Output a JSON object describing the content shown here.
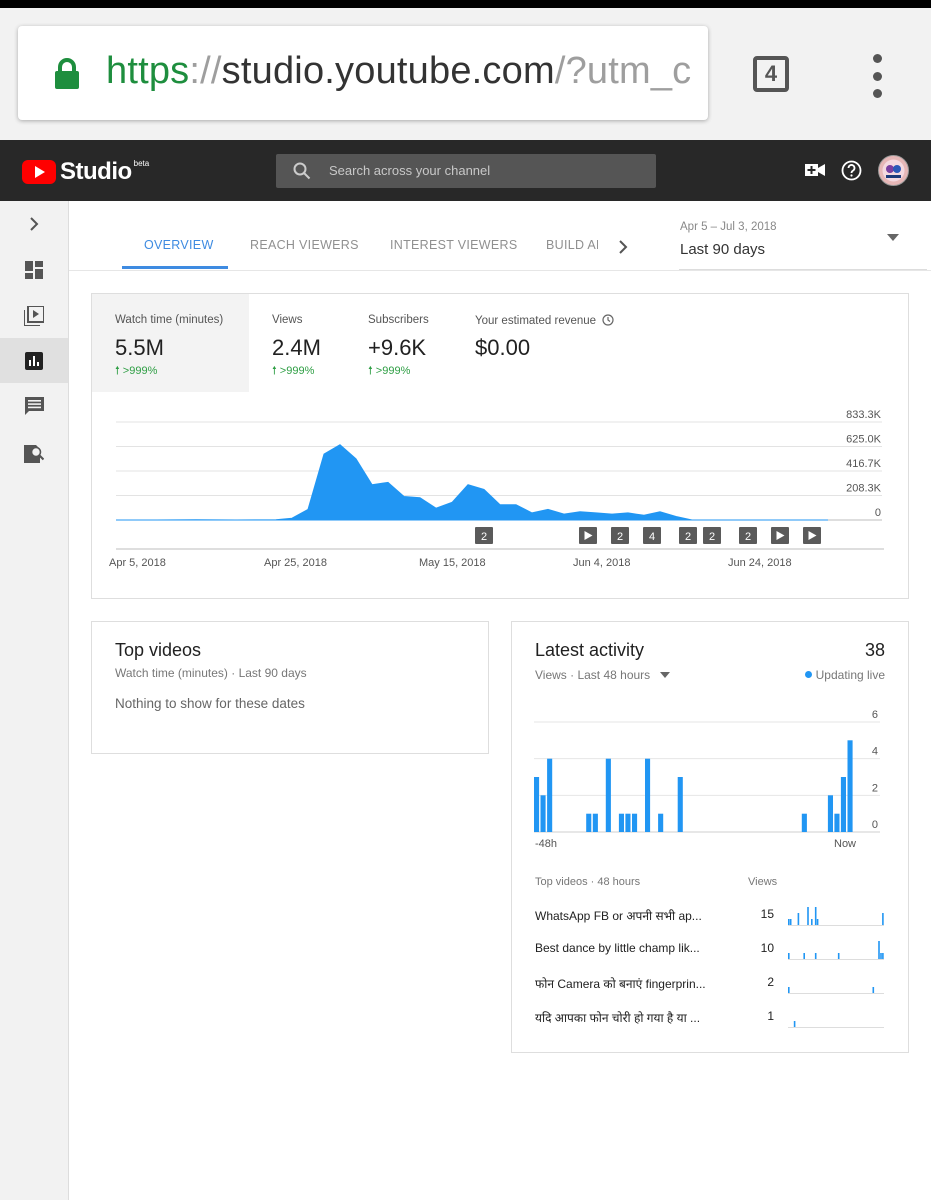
{
  "browser": {
    "url_scheme": "https",
    "url_sep": "://",
    "url_host": "studio.youtube.com",
    "url_rest": "/?utm_c",
    "tab_count": "4"
  },
  "header": {
    "studio_label": "Studio",
    "beta_label": "beta",
    "search_placeholder": "Search across your channel"
  },
  "tabs": [
    {
      "label": "OVERVIEW",
      "active": true
    },
    {
      "label": "REACH VIEWERS"
    },
    {
      "label": "INTEREST VIEWERS"
    },
    {
      "label": "BUILD AN"
    }
  ],
  "date_selector": {
    "range": "Apr 5 – Jul 3, 2018",
    "label": "Last 90 days"
  },
  "metrics": [
    {
      "label": "Watch time (minutes)",
      "value": "5.5M",
      "change": ">999%"
    },
    {
      "label": "Views",
      "value": "2.4M",
      "change": ">999%"
    },
    {
      "label": "Subscribers",
      "value": "+9.6K",
      "change": ">999%"
    },
    {
      "label": "Your estimated revenue",
      "value": "$0.00"
    }
  ],
  "chart_data": [
    {
      "type": "area",
      "y_ticks": [
        "833.3K",
        "625.0K",
        "416.7K",
        "208.3K",
        "0"
      ],
      "x_ticks": [
        "Apr 5, 2018",
        "Apr 25, 2018",
        "May 15, 2018",
        "Jun 4, 2018",
        "Jun 24, 2018"
      ],
      "ylim": [
        0,
        833300
      ],
      "x_days": [
        0,
        5,
        10,
        15,
        20,
        22,
        24,
        26,
        28,
        30,
        32,
        34,
        36,
        38,
        40,
        42,
        44,
        46,
        48,
        50,
        52,
        54,
        56,
        58,
        60,
        62,
        64,
        66,
        68,
        70,
        72,
        75,
        80,
        85,
        89
      ],
      "values": [
        0,
        0,
        2000,
        0,
        2000,
        15000,
        90000,
        560000,
        640000,
        520000,
        300000,
        320000,
        200000,
        190000,
        100000,
        150000,
        300000,
        260000,
        130000,
        130000,
        60000,
        90000,
        50000,
        70000,
        60000,
        50000,
        60000,
        40000,
        70000,
        30000,
        0,
        0,
        0,
        0,
        0
      ],
      "grid": true,
      "annotations": [
        {
          "day": 46,
          "label": "2"
        },
        {
          "day": 59,
          "label": "play"
        },
        {
          "day": 63,
          "label": "2"
        },
        {
          "day": 67,
          "label": "4"
        },
        {
          "day": 71.5,
          "label": "2"
        },
        {
          "day": 74.5,
          "label": "2"
        },
        {
          "day": 79,
          "label": "2"
        },
        {
          "day": 83,
          "label": "play"
        },
        {
          "day": 87,
          "label": "play"
        }
      ]
    },
    {
      "type": "bar",
      "series_label": "Views",
      "y_ticks": [
        "6",
        "4",
        "2",
        "0"
      ],
      "ylim": [
        0,
        6
      ],
      "x_ticks": [
        "-48h",
        "Now"
      ],
      "values": [
        3,
        2,
        4,
        0,
        0,
        0,
        0,
        0,
        1,
        1,
        0,
        4,
        0,
        1,
        1,
        1,
        0,
        4,
        0,
        1,
        0,
        0,
        3,
        0,
        0,
        0,
        0,
        0,
        0,
        0,
        0,
        0,
        0,
        0,
        0,
        0,
        0,
        0,
        0,
        0,
        0,
        1,
        0,
        0,
        0,
        2,
        1,
        3,
        5
      ]
    }
  ],
  "top_videos": {
    "title": "Top videos",
    "subtitle": "Watch time (minutes) · Last 90 days",
    "empty_text": "Nothing to show for these dates"
  },
  "latest_activity": {
    "title": "Latest activity",
    "total": "38",
    "subtitle": "Views · Last 48 hours",
    "live_label": "Updating live",
    "table_header_left": "Top videos · 48 hours",
    "table_header_right": "Views",
    "videos": [
      {
        "title": "WhatsApp FB or अपनी सभी ap...",
        "views": "15",
        "spark": [
          1,
          1,
          0,
          0,
          0,
          2,
          0,
          0,
          0,
          0,
          3,
          0,
          1,
          0,
          3,
          1,
          0,
          0,
          0,
          0,
          0,
          0,
          0,
          0,
          0,
          0,
          0,
          0,
          0,
          0,
          0,
          0,
          0,
          0,
          0,
          0,
          0,
          0,
          0,
          0,
          0,
          0,
          0,
          0,
          0,
          0,
          0,
          0,
          0,
          2
        ]
      },
      {
        "title": "Best dance by little champ lik...",
        "views": "10",
        "spark": [
          1,
          0,
          0,
          0,
          0,
          0,
          0,
          0,
          1,
          0,
          0,
          0,
          0,
          0,
          1,
          0,
          0,
          0,
          0,
          0,
          0,
          0,
          0,
          0,
          0,
          0,
          1,
          0,
          0,
          0,
          0,
          0,
          0,
          0,
          0,
          0,
          0,
          0,
          0,
          0,
          0,
          0,
          0,
          0,
          0,
          0,
          0,
          3,
          1,
          1
        ]
      },
      {
        "title": "फोन Camera को बनाएं fingerprin...",
        "views": "2",
        "spark": [
          1,
          0,
          0,
          0,
          0,
          0,
          0,
          0,
          0,
          0,
          0,
          0,
          0,
          0,
          0,
          0,
          0,
          0,
          0,
          0,
          0,
          0,
          0,
          0,
          0,
          0,
          0,
          0,
          0,
          0,
          0,
          0,
          0,
          0,
          0,
          0,
          0,
          0,
          0,
          0,
          0,
          0,
          0,
          0,
          1,
          0,
          0,
          0,
          0,
          0
        ]
      },
      {
        "title": "यदि आपका फोन चोरी हो गया है या ...",
        "views": "1",
        "spark": [
          0,
          0,
          0,
          1,
          0,
          0,
          0,
          0,
          0,
          0,
          0,
          0,
          0,
          0,
          0,
          0,
          0,
          0,
          0,
          0,
          0,
          0,
          0,
          0,
          0,
          0,
          0,
          0,
          0,
          0,
          0,
          0,
          0,
          0,
          0,
          0,
          0,
          0,
          0,
          0,
          0,
          0,
          0,
          0,
          0,
          0,
          0,
          0,
          0,
          0
        ]
      }
    ]
  },
  "colors": {
    "accent": "#3e8be1",
    "chart_fill": "#2196f3",
    "positive": "#2e9e44",
    "youtube_red": "#ff0000",
    "header_bg": "#282828"
  }
}
